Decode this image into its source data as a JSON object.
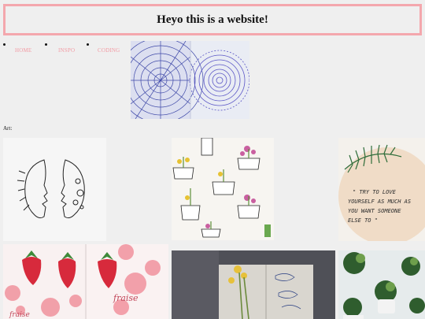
{
  "header": {
    "title": "Heyo this is a website!"
  },
  "nav": {
    "items": [
      {
        "label": "HOME"
      },
      {
        "label": "INSPO"
      },
      {
        "label": "CODING"
      }
    ]
  },
  "gallery": {
    "heading": "Art:",
    "quote_lines": [
      "\" TRY TO LOVE",
      "YOURSELF AS MUCH AS",
      "YOU WANT SOMEONE",
      "ELSE TO \""
    ],
    "handwriting": "fraise"
  },
  "colors": {
    "accent": "#f4a7ad",
    "nav_link": "#f29aa3",
    "background": "#efefef"
  }
}
